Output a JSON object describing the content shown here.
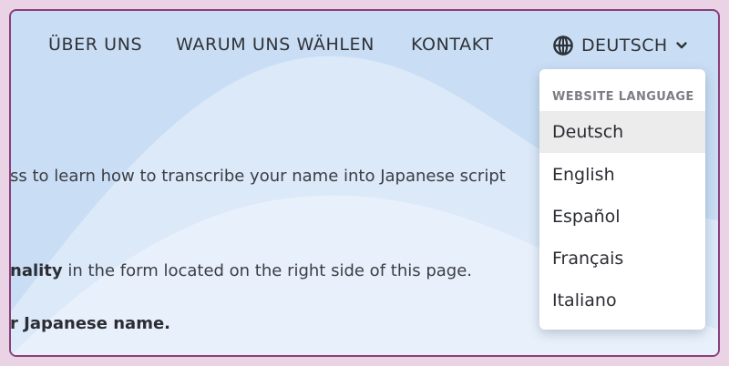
{
  "nav": {
    "links": [
      "ÜBER UNS",
      "WARUM UNS WÄHLEN",
      "KONTAKT"
    ],
    "language_label": "DEUTSCH",
    "globe_icon": "globe-icon",
    "chevron_icon": "chevron-down-icon"
  },
  "content": {
    "line1": "ss to learn how to transcribe your name into Japanese script",
    "line2_bold": "nality",
    "line2_rest": " in the form located on the right side of this page.",
    "line3_bold": "r Japanese name."
  },
  "language_menu": {
    "header": "WEBSITE LANGUAGE",
    "selected": "Deutsch",
    "options": [
      "Deutsch",
      "English",
      "Español",
      "Français",
      "Italiano"
    ]
  },
  "colors": {
    "page_background": "#e9d3e4",
    "frame_border": "#8a3f78",
    "sky": "#c9def4",
    "selected_item": "#ececec"
  }
}
